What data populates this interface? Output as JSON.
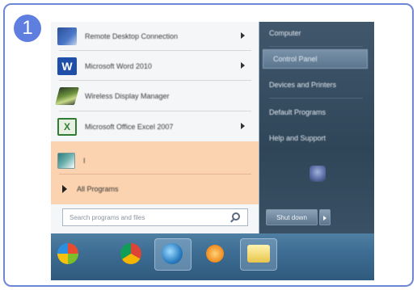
{
  "badge": {
    "step": "1"
  },
  "start_menu": {
    "programs": [
      {
        "label": "Remote Desktop Connection",
        "icon": "remote-desktop-icon",
        "has_submenu": true
      },
      {
        "label": "Microsoft Word 2010",
        "icon": "word-icon",
        "has_submenu": true
      },
      {
        "label": "Wireless Display Manager",
        "icon": "wireless-display-icon",
        "has_submenu": false
      },
      {
        "label": "Microsoft Office Excel 2007",
        "icon": "excel-icon",
        "has_submenu": true
      },
      {
        "label": "I",
        "icon": "program-icon",
        "has_submenu": false
      }
    ],
    "all_programs": "All Programs",
    "search_placeholder": "Search programs and files",
    "right_items": [
      {
        "label": "Computer",
        "active": false
      },
      {
        "label": "Control Panel",
        "active": true
      },
      {
        "label": "Devices and Printers",
        "active": false
      },
      {
        "label": "Default Programs",
        "active": false
      },
      {
        "label": "Help and Support",
        "active": false
      }
    ],
    "shutdown_label": "Shut down"
  },
  "taskbar": {
    "icons": [
      "windows-start-icon",
      "chrome-icon",
      "windows-media-icon",
      "media-player-icon",
      "explorer-folder-icon"
    ]
  },
  "colors": {
    "frame_border": "#6d87d6",
    "badge": "#5f7fe0",
    "highlight": "#fbd3b0"
  }
}
